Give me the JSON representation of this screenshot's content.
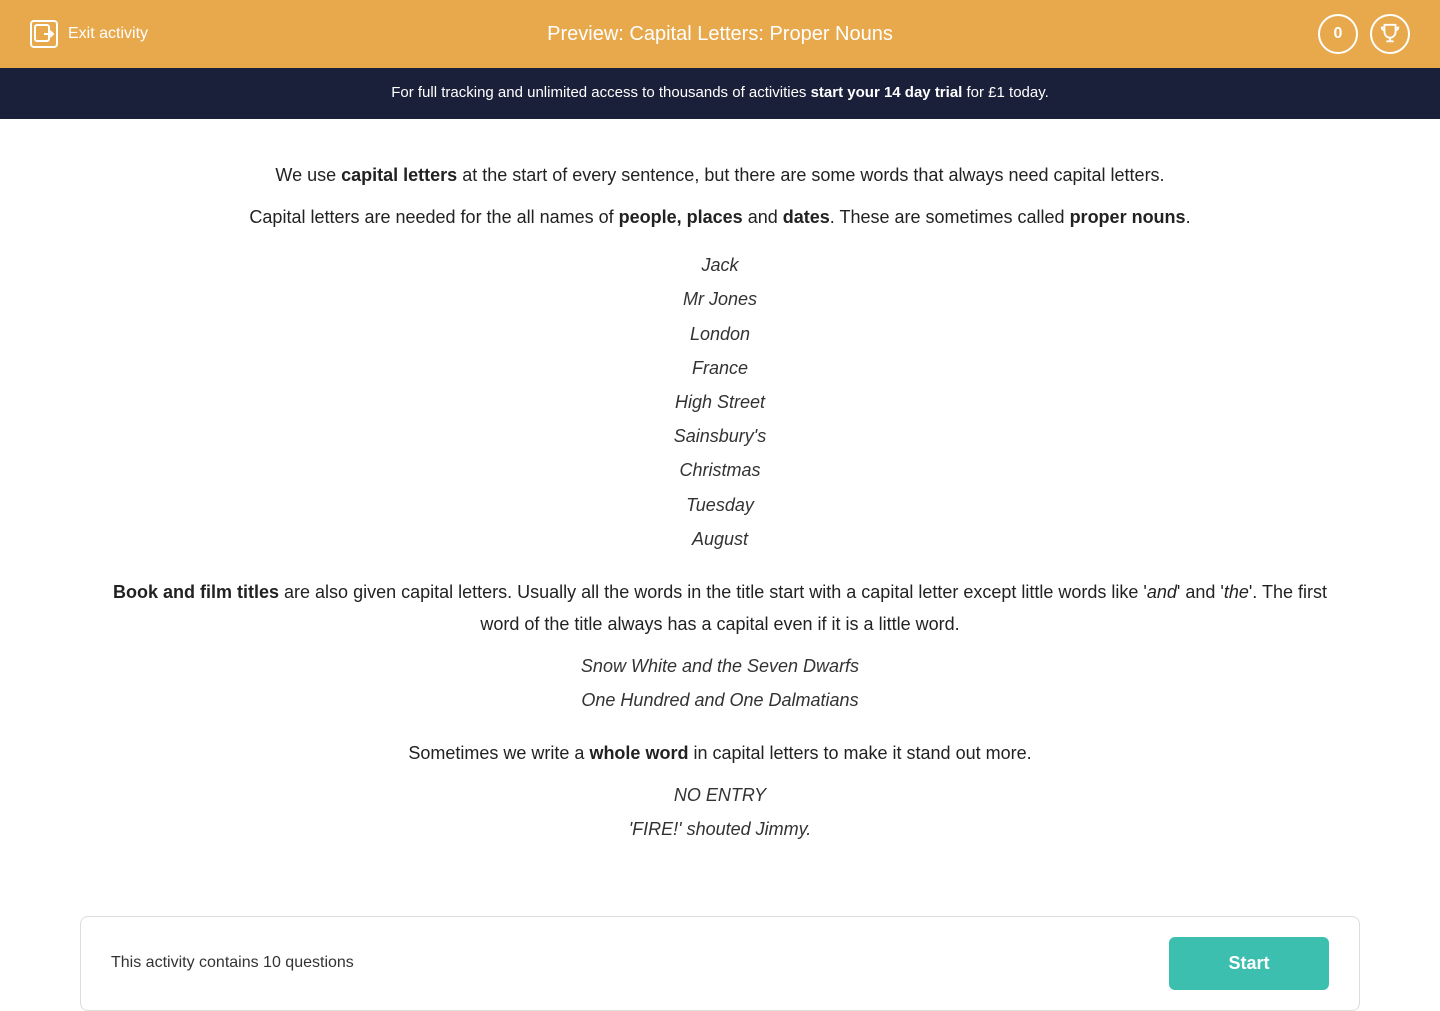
{
  "header": {
    "exit_label": "Exit activity",
    "title": "Preview: Capital Letters: Proper Nouns",
    "score": "0",
    "trophy_icon": "🏆",
    "exit_icon": "→"
  },
  "banner": {
    "text_before": "For full tracking and unlimited access to thousands of activities ",
    "cta_text": "start your 14 day trial",
    "text_after": " for £1 today."
  },
  "main": {
    "intro_line1_before": "We use ",
    "intro_bold1": "capital letters",
    "intro_line1_after": " at the start of every sentence, but there are some words that always need capital letters.",
    "intro_line2_before": "Capital letters are needed for the all names of ",
    "intro_bold2": "people, places",
    "intro_line2_mid": " and ",
    "intro_bold3": "dates",
    "intro_line2_after": ". These are sometimes called ",
    "intro_bold4": "proper nouns",
    "intro_line2_end": ".",
    "examples": [
      "Jack",
      "Mr Jones",
      "London",
      "France",
      "High Street",
      "Sainsbury's",
      "Christmas",
      "Tuesday",
      "August"
    ],
    "section2_bold": "Book and film titles",
    "section2_text": " are also given capital letters. Usually all the words in the title start with a capital letter except little words like '",
    "section2_italic1": "and",
    "section2_text2": "' and '",
    "section2_italic2": "the",
    "section2_text3": "'. The first word of the title always has a capital even if it is a little word.",
    "film_titles": [
      "Snow White and the Seven Dwarfs",
      "One Hundred and One Dalmatians"
    ],
    "section3_before": "Sometimes we write a ",
    "section3_bold": "whole word",
    "section3_after": " in capital letters to make it stand out more.",
    "whole_word_examples": [
      "NO ENTRY",
      "'FIRE!' shouted Jimmy."
    ],
    "footer_text": "This activity contains 10 questions",
    "start_button": "Start"
  }
}
